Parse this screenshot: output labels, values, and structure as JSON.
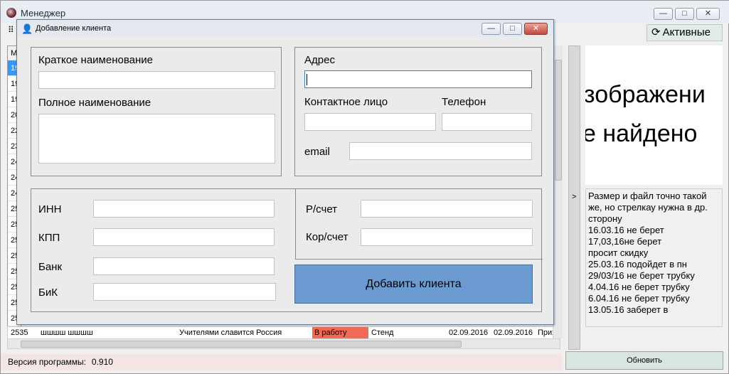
{
  "main": {
    "title": "Менеджер",
    "win_buttons": {
      "minimize": "—",
      "maximize": "□",
      "close": "✕"
    },
    "toolbar_icon": "⠿",
    "active_filter": {
      "label": "Активные",
      "icon": "refresh-icon"
    },
    "grid_rows": [
      "М",
      "19",
      "19",
      "19",
      "20",
      "22",
      "23",
      "24",
      "24",
      "24",
      "25",
      "25",
      "25",
      "25",
      "25",
      "25",
      "25",
      "25"
    ],
    "grid_bottom_row": {
      "id": "2535",
      "name": "шшшш шшшш",
      "org": "Учителями славится Россия",
      "status": "В работу",
      "type": "Стенд",
      "date1": "02.09.2016",
      "date2": "02.09.2016",
      "extra": "Прих"
    },
    "expand_arrow": ">",
    "image_placeholder": {
      "line1": "зображени",
      "line2": "е найдено"
    },
    "notes": [
      "Размер и файл точно такой же, но стрелкау нужна в др. сторону",
      "16.03.16 не берет",
      "17,03,16не берет",
      "просит скидку",
      "25.03.16 подойдет в пн",
      "29/03/16 не берет трубку",
      "4.04.16 не берет трубку",
      "6.04.16 не берет трубку",
      "13.05.16 заберет в"
    ],
    "refresh_label": "Обновить",
    "version_label": "Версия программы:",
    "version_value": "0.910"
  },
  "dialog": {
    "title": "Добавление клиента",
    "short_name_label": "Краткое наименование",
    "full_name_label": "Полное наименование",
    "address_label": "Адрес",
    "contact_label": "Контактное лицо",
    "phone_label": "Телефон",
    "email_label": "email",
    "inn_label": "ИНН",
    "kpp_label": "КПП",
    "bank_label": "Банк",
    "bik_label": "БиК",
    "account_label": "Р/счет",
    "corr_account_label": "Кор/счет",
    "add_button_label": "Добавить клиента",
    "values": {
      "short_name": "",
      "full_name": "",
      "address": "",
      "contact": "",
      "phone": "",
      "email": "",
      "inn": "",
      "kpp": "",
      "bank": "",
      "bik": "",
      "account": "",
      "corr_account": ""
    }
  }
}
